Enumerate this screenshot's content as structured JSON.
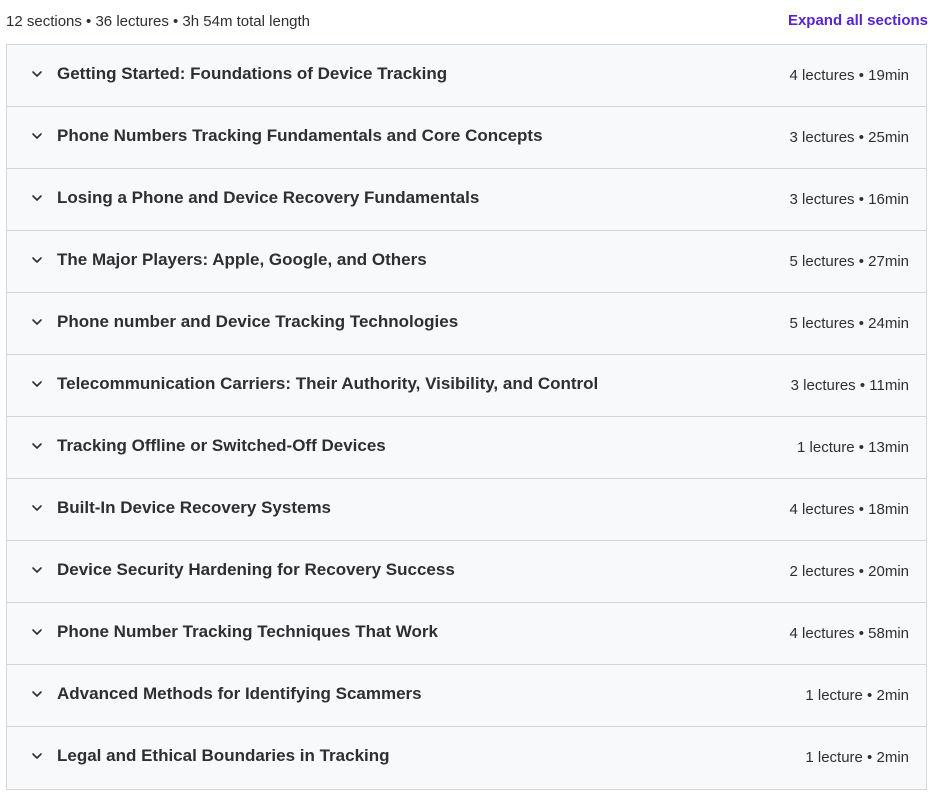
{
  "summary": {
    "text": "12 sections • 36 lectures • 3h 54m total length",
    "expand_label": "Expand all sections"
  },
  "colors": {
    "accent": "#5624d0",
    "row_background": "#f7f9fa",
    "border": "#d1d7dc"
  },
  "sections": [
    {
      "title": "Getting Started: Foundations of Device Tracking",
      "meta": "4 lectures • 19min",
      "icon": "chevron-down-icon"
    },
    {
      "title": "Phone Numbers Tracking Fundamentals and Core Concepts",
      "meta": "3 lectures • 25min",
      "icon": "chevron-down-icon"
    },
    {
      "title": "Losing a Phone and Device Recovery Fundamentals",
      "meta": "3 lectures • 16min",
      "icon": "chevron-down-icon"
    },
    {
      "title": "The Major Players: Apple, Google, and Others",
      "meta": "5 lectures • 27min",
      "icon": "chevron-down-icon"
    },
    {
      "title": "Phone number and Device Tracking Technologies",
      "meta": "5 lectures • 24min",
      "icon": "chevron-down-icon"
    },
    {
      "title": "Telecommunication Carriers: Their Authority, Visibility, and Control",
      "meta": "3 lectures • 11min",
      "icon": "chevron-down-icon"
    },
    {
      "title": "Tracking Offline or Switched-Off Devices",
      "meta": "1 lecture • 13min",
      "icon": "chevron-down-icon"
    },
    {
      "title": "Built-In Device Recovery Systems",
      "meta": "4 lectures • 18min",
      "icon": "chevron-down-icon"
    },
    {
      "title": "Device Security Hardening for Recovery Success",
      "meta": "2 lectures • 20min",
      "icon": "chevron-down-icon"
    },
    {
      "title": "Phone Number Tracking Techniques That Work",
      "meta": "4 lectures • 58min",
      "icon": "chevron-down-icon"
    },
    {
      "title": "Advanced Methods for Identifying Scammers",
      "meta": "1 lecture • 2min",
      "icon": "chevron-down-icon"
    },
    {
      "title": "Legal and Ethical Boundaries in Tracking",
      "meta": "1 lecture • 2min",
      "icon": "chevron-down-icon"
    }
  ]
}
